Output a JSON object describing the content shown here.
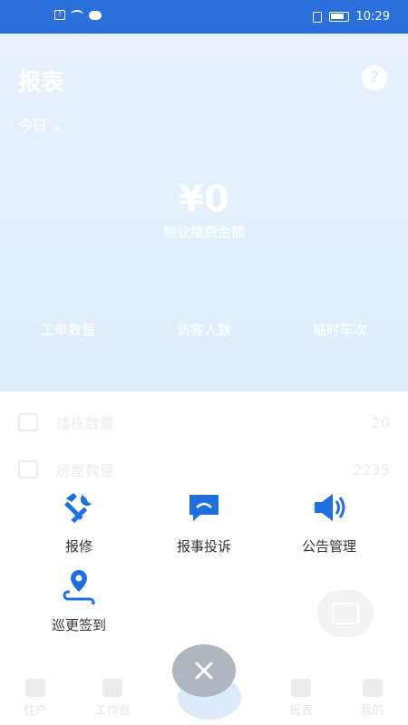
{
  "status_bar": {
    "time": "10:29"
  },
  "report": {
    "title": "报表",
    "help": "?",
    "date_filter": "今日 ⌄",
    "amount": "¥0",
    "amount_label": "物业缴费金额",
    "stats": [
      "工单数量",
      "访客人数",
      "临时车次"
    ]
  },
  "list": [
    {
      "label": "楼栋数量",
      "value": "20"
    },
    {
      "label": "房屋数量",
      "value": "2235"
    }
  ],
  "actions": [
    {
      "label": "报修",
      "icon": "tools-icon"
    },
    {
      "label": "报事投诉",
      "icon": "chat-icon"
    },
    {
      "label": "公告管理",
      "icon": "speaker-icon"
    },
    {
      "label": "巡更签到",
      "icon": "location-icon"
    }
  ],
  "tabs": [
    "住户",
    "工作台",
    "报表",
    "我的"
  ],
  "colors": {
    "accent": "#2b6fdc",
    "action_icon": "#1f6fe0",
    "close_button": "#b0b6bf"
  }
}
